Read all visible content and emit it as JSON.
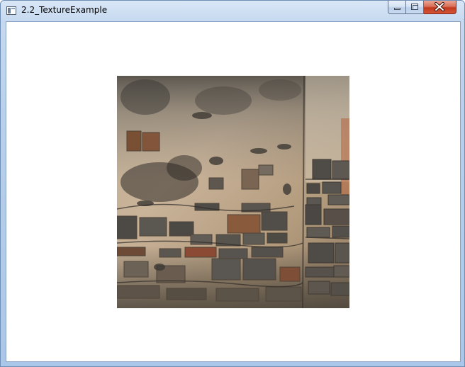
{
  "window": {
    "title": "2.2_TextureExample",
    "controls": [
      "minimize",
      "maximize",
      "close"
    ]
  },
  "canvas": {
    "background": "#ffffff",
    "image": "brick-wall-texture"
  }
}
